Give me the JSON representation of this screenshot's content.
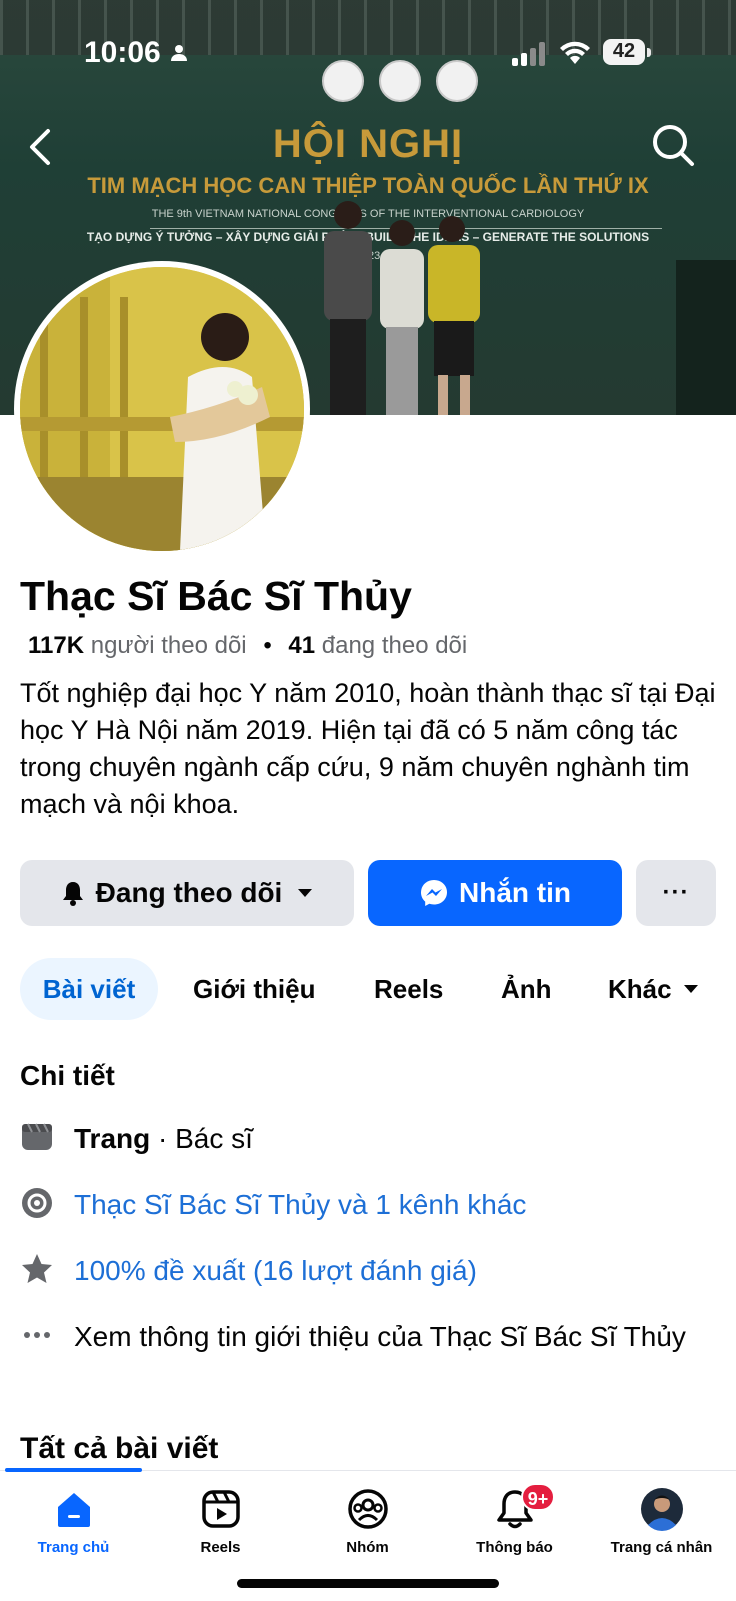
{
  "status_bar": {
    "time": "10:06",
    "battery": "42"
  },
  "cover": {
    "banner_title": "HỘI NGHỊ",
    "banner_subtitle": "TIM MẠCH HỌC CAN THIỆP TOÀN QUỐC LẦN THỨ IX",
    "banner_english": "THE 9th VIETNAM NATIONAL CONGRESS OF THE INTERVENTIONAL CARDIOLOGY",
    "banner_slogan": "TẠO DỰNG Ý TƯỞNG – XÂY DỰNG GIẢI PHÁP - BUILD THE IDEAS – GENERATE THE SOLUTIONS",
    "banner_date": "2023"
  },
  "profile": {
    "name": "Thạc Sĩ Bác Sĩ Thủy",
    "followers_count": "117K",
    "followers_label": "người theo dõi",
    "following_count": "41",
    "following_label": "đang theo dõi",
    "bio": "Tốt nghiệp đại học Y năm 2010, hoàn thành thạc sĩ tại Đại học Y Hà Nội năm 2019. Hiện tại đã có 5 năm công tác trong chuyên ngành cấp cứu, 9 năm chuyên nghành tim mạch và nội khoa."
  },
  "actions": {
    "follow_label": "Đang theo dõi",
    "message_label": "Nhắn tin",
    "more_label": "···"
  },
  "tabs": [
    {
      "label": "Bài viết",
      "active": true
    },
    {
      "label": "Giới thiệu"
    },
    {
      "label": "Reels"
    },
    {
      "label": "Ảnh"
    },
    {
      "label": "Khác"
    }
  ],
  "details": {
    "heading": "Chi tiết",
    "page_type_bold": "Trang",
    "page_type_rest": " · Bác sĩ",
    "channels_link": "Thạc Sĩ Bác Sĩ Thủy và 1 kênh khác",
    "rating_link": "100% đề xuất (16 lượt đánh giá)",
    "see_about": "Xem thông tin giới thiệu của Thạc Sĩ Bác Sĩ Thủy"
  },
  "all_posts_heading": "Tất cả bài viết",
  "bottom_nav": [
    {
      "label": "Trang chủ",
      "icon": "home-icon",
      "active": true
    },
    {
      "label": "Reels",
      "icon": "reels-icon"
    },
    {
      "label": "Nhóm",
      "icon": "groups-icon"
    },
    {
      "label": "Thông báo",
      "icon": "bell-icon",
      "badge": "9+"
    },
    {
      "label": "Trang cá nhân",
      "icon": "avatar-icon"
    }
  ],
  "colors": {
    "accent": "#0866ff",
    "link": "#1d6fd6",
    "badge": "#e41e3f",
    "tab_active_bg": "#ebf5ff"
  }
}
